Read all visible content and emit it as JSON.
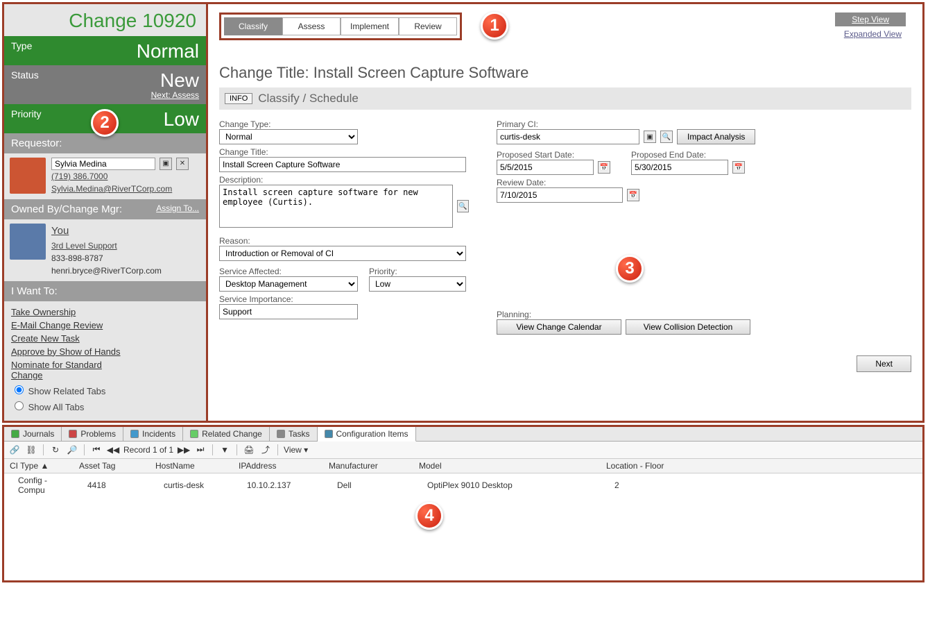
{
  "header": {
    "title": "Change 10920"
  },
  "summary": {
    "type_label": "Type",
    "type_value": "Normal",
    "status_label": "Status",
    "status_value": "New",
    "status_next": "Next: Assess",
    "priority_label": "Priority",
    "priority_value": "Low"
  },
  "requestor": {
    "section": "Requestor:",
    "name": "Sylvia Medina",
    "phone": "(719) 386.7000",
    "email": "Sylvia.Medina@RiverTCorp.com"
  },
  "owner": {
    "section": "Owned By/Change Mgr:",
    "assign": "Assign To...",
    "name": "You",
    "team": "3rd Level Support",
    "phone": "833-898-8787",
    "email": "henri.bryce@RiverTCorp.com"
  },
  "iwant": {
    "section": "I Want To:",
    "links": [
      "Take Ownership",
      "E-Mail Change Review",
      "Create New Task",
      "Approve by Show of Hands",
      "Nominate for Standard Change"
    ],
    "show_related": "Show Related Tabs",
    "show_all": "Show All Tabs"
  },
  "steps": {
    "tabs": [
      "Classify",
      "Assess",
      "Implement",
      "Review"
    ],
    "active": "Classify",
    "step_view": "Step View",
    "exp_view": "Expanded View"
  },
  "pane": {
    "title_prefix": "Change Title: ",
    "title": "Install Screen Capture Software",
    "section": "Classify / Schedule",
    "info": "INFO",
    "change_type_label": "Change Type:",
    "change_type": "Normal",
    "change_title_label": "Change Title:",
    "change_title": "Install Screen Capture Software",
    "description_label": "Description:",
    "description": "Install screen capture software for new employee (Curtis).",
    "reason_label": "Reason:",
    "reason": "Introduction or Removal of CI",
    "service_label": "Service Affected:",
    "service": "Desktop Management",
    "priority_label": "Priority:",
    "priority": "Low",
    "service_imp_label": "Service Importance:",
    "service_imp": "Support",
    "primary_ci_label": "Primary CI:",
    "primary_ci": "curtis-desk",
    "impact_btn": "Impact Analysis",
    "psd_label": "Proposed Start Date:",
    "psd": "5/5/2015",
    "ped_label": "Proposed End Date:",
    "ped": "5/30/2015",
    "review_label": "Review Date:",
    "review": "7/10/2015",
    "planning_label": "Planning:",
    "cal_btn": "View Change Calendar",
    "col_btn": "View Collision Detection",
    "next": "Next"
  },
  "bottom": {
    "tabs": [
      "Journals",
      "Problems",
      "Incidents",
      "Related Change",
      "Tasks",
      "Configuration Items"
    ],
    "active": "Configuration Items",
    "record_txt": "Record 1 of 1",
    "view": "View",
    "columns": [
      "CI Type",
      "Asset Tag",
      "HostName",
      "IPAddress",
      "Manufacturer",
      "Model",
      "Location - Floor"
    ],
    "rows": [
      {
        "ci": "Config - Compu",
        "asset": "4418",
        "host": "curtis-desk",
        "ip": "10.10.2.137",
        "mfr": "Dell",
        "model": "OptiPlex 9010 Desktop",
        "loc": "2"
      }
    ]
  },
  "badges": {
    "b1": "1",
    "b2": "2",
    "b3": "3",
    "b4": "4"
  }
}
